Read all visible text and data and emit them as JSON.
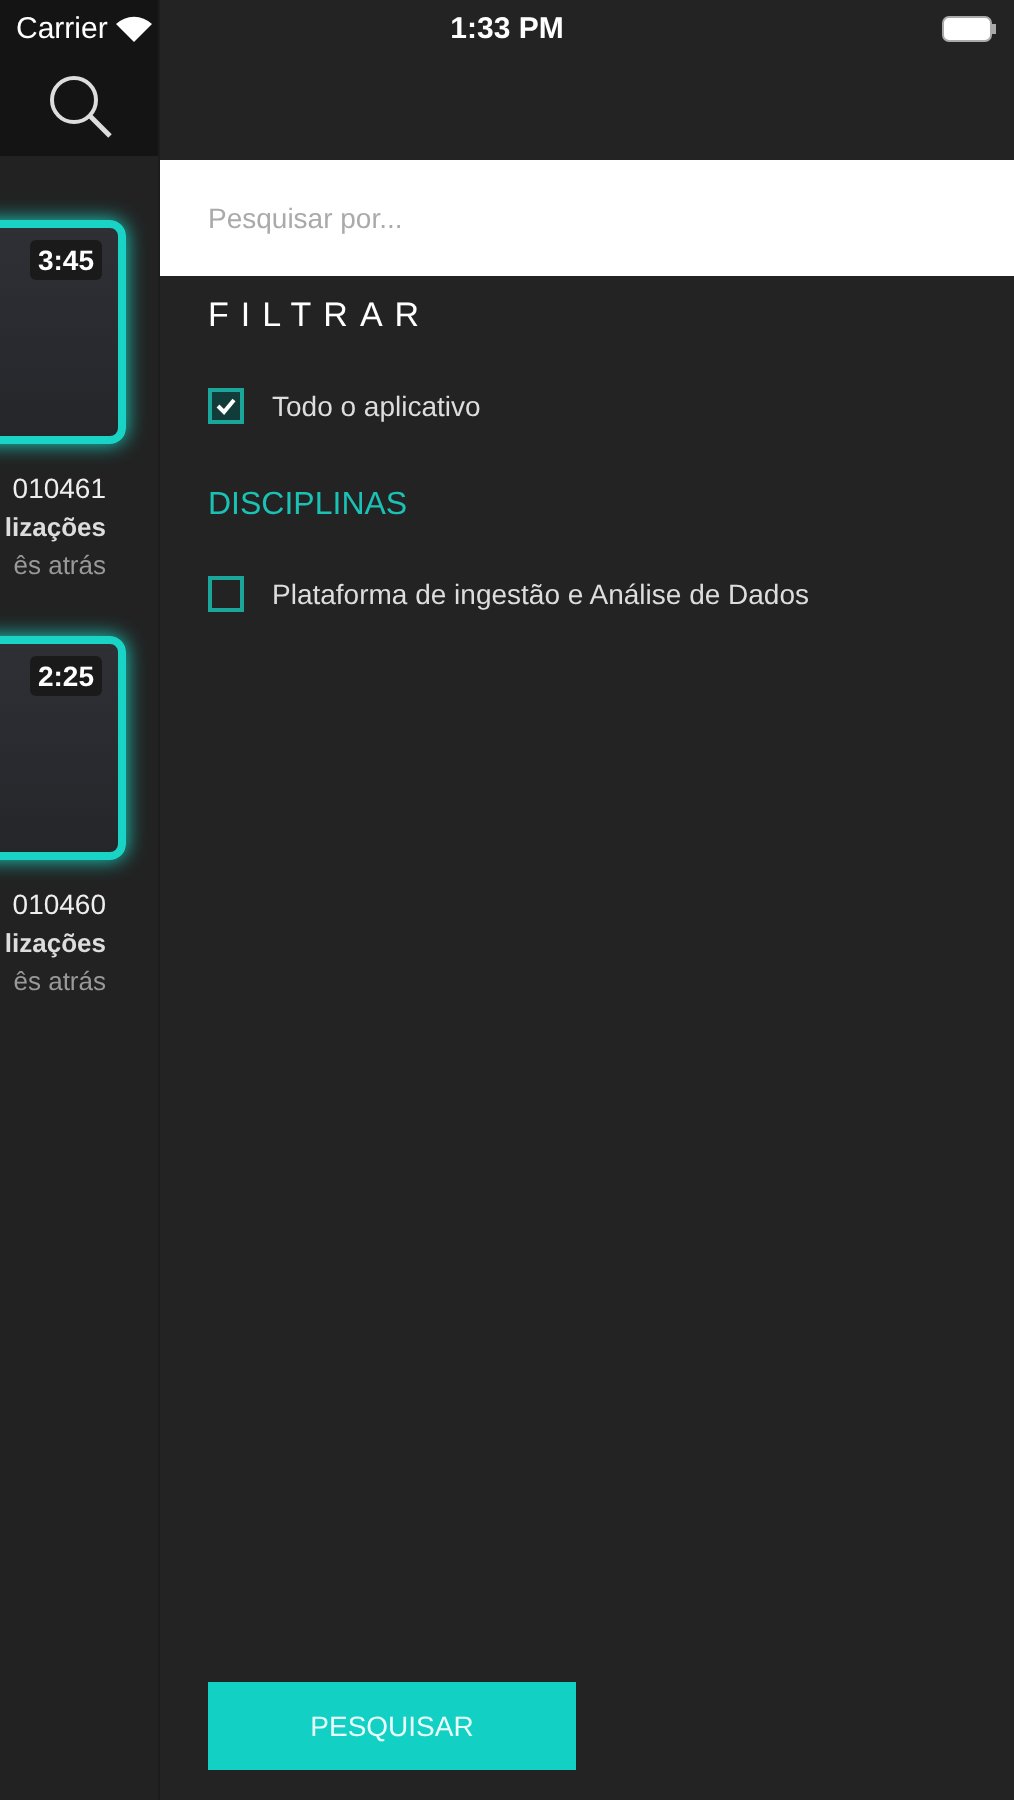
{
  "status_bar": {
    "carrier": "Carrier",
    "time": "1:33 PM"
  },
  "side_list": {
    "items": [
      {
        "duration": "3:45",
        "title": "010461",
        "subtitle": "lizações",
        "meta": "ês atrás"
      },
      {
        "duration": "2:25",
        "title": "010460",
        "subtitle": "lizações",
        "meta": "ês atrás"
      }
    ]
  },
  "search": {
    "placeholder": "Pesquisar por..."
  },
  "filter": {
    "title": "FILTRAR",
    "options": [
      {
        "label": "Todo o aplicativo",
        "checked": true
      }
    ]
  },
  "disciplines": {
    "title": "DISCIPLINAS",
    "options": [
      {
        "label": "Plataforma de ingestão e Análise de Dados",
        "checked": false
      }
    ]
  },
  "button": "PESQUISAR"
}
